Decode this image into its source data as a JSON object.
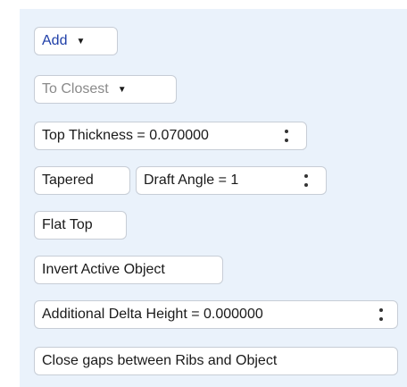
{
  "controls": {
    "add": {
      "label": "Add",
      "caret": "▼"
    },
    "closest": {
      "label": "To Closest",
      "caret": "▼"
    },
    "top_thickness": {
      "label": "Top Thickness = 0.070000"
    },
    "tapered": {
      "label": "Tapered"
    },
    "draft_angle": {
      "label": "Draft Angle = 1"
    },
    "flat_top": {
      "label": "Flat Top"
    },
    "invert": {
      "label": "Invert Active Object"
    },
    "delta_height": {
      "label": "Additional Delta Height  = 0.000000"
    },
    "close_gaps": {
      "label": "Close gaps between Ribs and Object"
    }
  },
  "colors": {
    "panel_bg": "#eaf2fb",
    "button_bg": "#ffffff",
    "border": "#c7cdd6",
    "accent_text": "#1f3fa8",
    "disabled_text": "#8a8a8a"
  },
  "icons": {
    "dropdown": "chevron-down-icon",
    "spinner": "spinner-updown-icon"
  }
}
